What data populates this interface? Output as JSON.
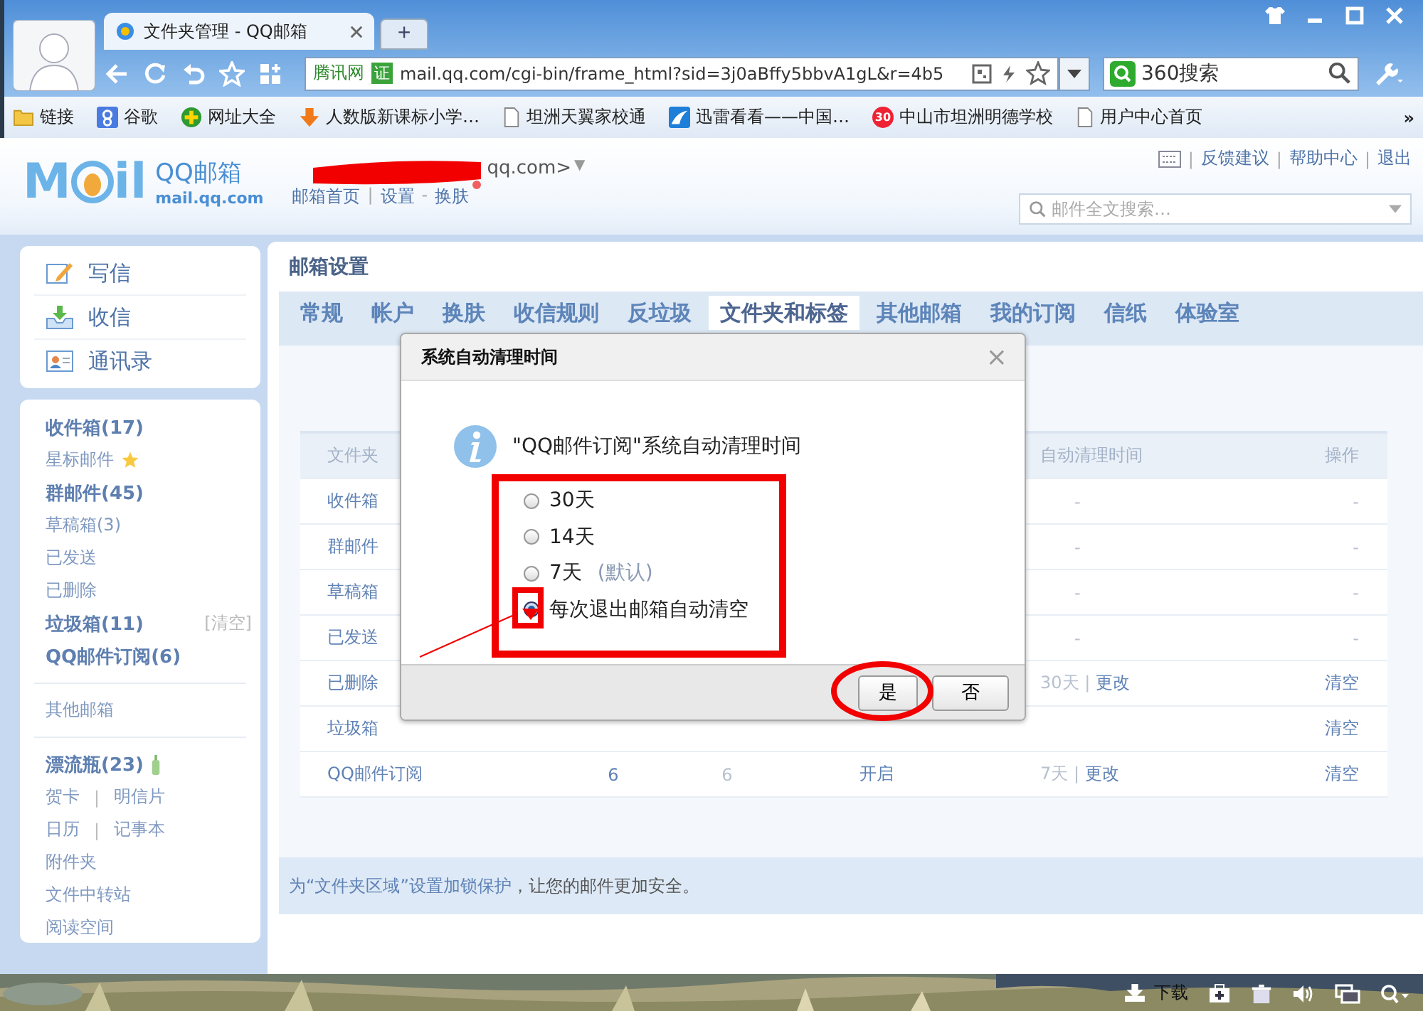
{
  "browser": {
    "tabs": [
      {
        "title": "文件夹管理 - QQ邮箱",
        "selected": true
      }
    ],
    "new_tab": "+",
    "address": {
      "site_badge": "腾讯网",
      "cert_badge": "证",
      "url": "mail.qq.com/cgi-bin/frame_html?sid=3j0aBffy5bbvA1gL&r=4b5"
    },
    "search": {
      "value": "360搜索"
    },
    "bookmarks": [
      {
        "label": "链接"
      },
      {
        "label": "谷歌"
      },
      {
        "label": "网址大全"
      },
      {
        "label": "人数版新课标小学…"
      },
      {
        "label": "坦洲天翼家校通"
      },
      {
        "label": "迅雷看看——中国…"
      },
      {
        "label": "中山市坦洲明德学校",
        "icon_text": "30"
      },
      {
        "label": "用户中心首页"
      }
    ],
    "bookmarks_more": "»"
  },
  "header": {
    "logo": {
      "left": "M",
      "right": "il"
    },
    "brand": "QQ邮箱",
    "domain": "mail.qq.com",
    "account": "qq.com>",
    "account_caret": "▼",
    "links": [
      {
        "label": "邮箱首页"
      },
      {
        "sep": "|",
        "label": "设置"
      },
      {
        "sep": "-",
        "label": "换肤"
      }
    ],
    "skin_new": true,
    "top_links": [
      {
        "sep": "|",
        "label": "反馈建议"
      },
      {
        "sep": "|",
        "label": "帮助中心"
      },
      {
        "sep": "|",
        "label": "退出"
      }
    ],
    "search_placeholder": "邮件全文搜索…"
  },
  "sidebar": {
    "actions": [
      {
        "label": "写信"
      },
      {
        "label": "收信"
      },
      {
        "label": "通讯录"
      }
    ],
    "groups": [
      [
        {
          "kind": "folder",
          "label": "收件箱(17)",
          "bold": true
        },
        {
          "kind": "starred",
          "label": "星标邮件",
          "bold": false
        },
        {
          "kind": "folder",
          "label": "群邮件(45)",
          "bold": true
        },
        {
          "kind": "folder",
          "label": "草稿箱(3)",
          "bold": false
        },
        {
          "kind": "folder",
          "label": "已发送",
          "bold": false
        },
        {
          "kind": "folder",
          "label": "已删除",
          "bold": false
        },
        {
          "kind": "folder",
          "label": "垃圾箱(11)",
          "bold": true,
          "action": "[清空]"
        },
        {
          "kind": "folder",
          "label": "QQ邮件订阅(6)",
          "bold": true
        }
      ],
      [
        {
          "kind": "folder",
          "label": "其他邮箱",
          "bold": false
        }
      ],
      [
        {
          "kind": "bottle",
          "label": "漂流瓶(23)",
          "bold": true
        },
        {
          "kind": "pair",
          "links": [
            "贺卡",
            "明信片"
          ],
          "sep": "|"
        },
        {
          "kind": "pair",
          "links": [
            "日历",
            "记事本"
          ],
          "sep": "|"
        },
        {
          "kind": "folder",
          "label": "附件夹",
          "bold": false
        },
        {
          "kind": "folder",
          "label": "文件中转站",
          "bold": false
        },
        {
          "kind": "folder",
          "label": "阅读空间",
          "bold": false
        }
      ]
    ]
  },
  "main": {
    "title": "邮箱设置",
    "tabs": [
      {
        "label": "常规",
        "selected": false
      },
      {
        "label": "帐户",
        "selected": false
      },
      {
        "label": "换肤",
        "selected": false
      },
      {
        "label": "收信规则",
        "selected": false
      },
      {
        "label": "反垃圾",
        "selected": false
      },
      {
        "label": "文件夹和标签",
        "selected": true
      },
      {
        "label": "其他邮箱",
        "selected": false
      },
      {
        "label": "我的订阅",
        "selected": false
      },
      {
        "label": "信纸",
        "selected": false
      },
      {
        "label": "体验室",
        "selected": false
      }
    ],
    "table": {
      "columns": [
        "文件夹",
        "自动清理时间",
        "操作"
      ],
      "rows": [
        {
          "name": "收件箱",
          "clean": "-",
          "action": "-"
        },
        {
          "name": "群邮件",
          "clean": "-",
          "action": "-"
        },
        {
          "name": "草稿箱",
          "clean": "-",
          "action": "-"
        },
        {
          "name": "已发送",
          "clean": "-",
          "action": "-"
        },
        {
          "name": "已删除",
          "clean_days": "30天",
          "clean_sep": "|",
          "clean_link": "更改",
          "action": "清空"
        },
        {
          "name": "垃圾箱",
          "action": "清空"
        },
        {
          "name": "QQ邮件订阅",
          "total": "6",
          "unread": "6",
          "status": "开启",
          "clean_days": "7天",
          "clean_sep": "|",
          "clean_link": "更改",
          "action": "清空"
        }
      ]
    },
    "note": {
      "link": "为“文件夹区域”设置加锁保护",
      "text": "，让您的邮件更加安全。"
    }
  },
  "dialog": {
    "title": "系统自动清理时间",
    "close": "×",
    "message": "\"QQ邮件订阅\"系统自动清理时间",
    "options": [
      {
        "label": "30天",
        "selected": false
      },
      {
        "label": "14天",
        "selected": false
      },
      {
        "label": "7天",
        "note": "(默认)",
        "selected": false
      },
      {
        "label": "每次退出邮箱自动清空",
        "selected": true
      }
    ],
    "buttons": [
      "是",
      "否"
    ]
  },
  "status_bar": {
    "download": "下载"
  }
}
